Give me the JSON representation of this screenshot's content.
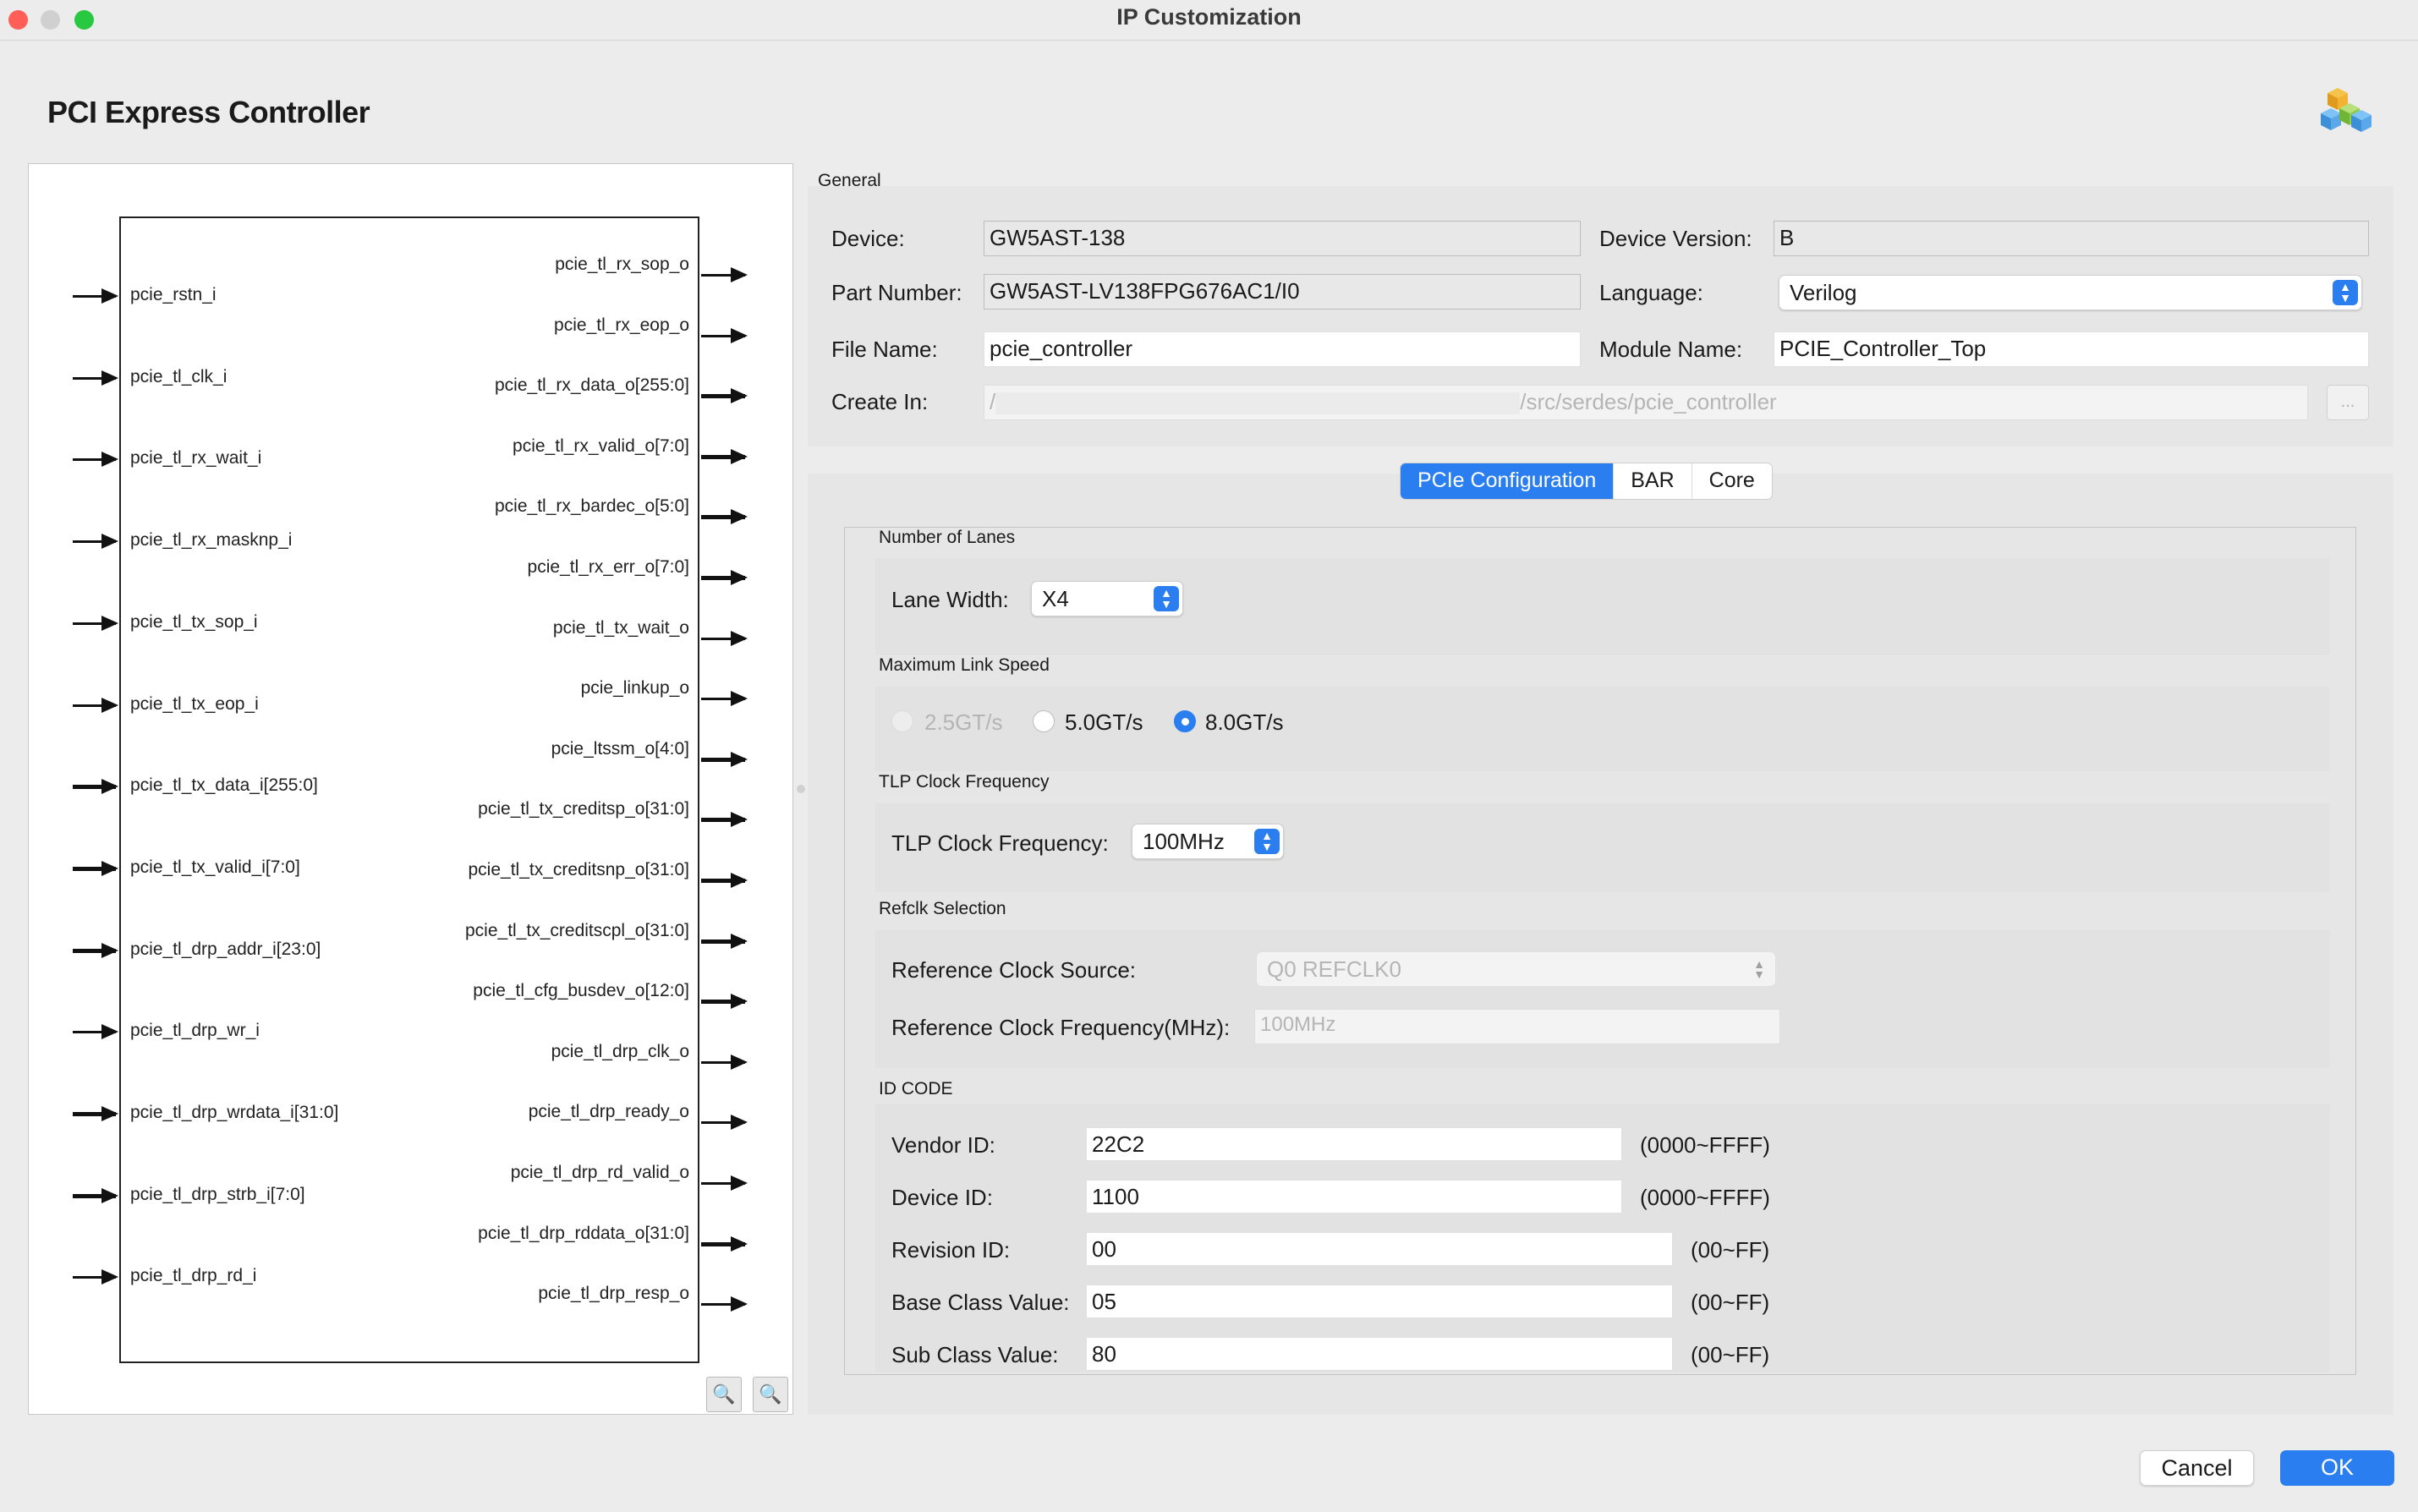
{
  "window": {
    "title": "IP Customization"
  },
  "header": {
    "title": "PCI Express Controller",
    "logo_icon": "ip-cubes-icon"
  },
  "diagram": {
    "left_pins": [
      "pcie_rstn_i",
      "pcie_tl_clk_i",
      "pcie_tl_rx_wait_i",
      "pcie_tl_rx_masknp_i",
      "pcie_tl_tx_sop_i",
      "pcie_tl_tx_eop_i",
      "pcie_tl_tx_data_i[255:0]",
      "pcie_tl_tx_valid_i[7:0]",
      "pcie_tl_drp_addr_i[23:0]",
      "pcie_tl_drp_wr_i",
      "pcie_tl_drp_wrdata_i[31:0]",
      "pcie_tl_drp_strb_i[7:0]",
      "pcie_tl_drp_rd_i"
    ],
    "right_pins": [
      "pcie_tl_rx_sop_o",
      "pcie_tl_rx_eop_o",
      "pcie_tl_rx_data_o[255:0]",
      "pcie_tl_rx_valid_o[7:0]",
      "pcie_tl_rx_bardec_o[5:0]",
      "pcie_tl_rx_err_o[7:0]",
      "pcie_tl_tx_wait_o",
      "pcie_linkup_o",
      "pcie_ltssm_o[4:0]",
      "pcie_tl_tx_creditsp_o[31:0]",
      "pcie_tl_tx_creditsnp_o[31:0]",
      "pcie_tl_tx_creditscpl_o[31:0]",
      "pcie_tl_cfg_busdev_o[12:0]",
      "pcie_tl_drp_clk_o",
      "pcie_tl_drp_ready_o",
      "pcie_tl_drp_rd_valid_o",
      "pcie_tl_drp_rddata_o[31:0]",
      "pcie_tl_drp_resp_o"
    ],
    "zoom_in_icon": "zoom-in-icon",
    "zoom_out_icon": "zoom-out-icon"
  },
  "general": {
    "section_label": "General",
    "device_label": "Device:",
    "device_value": "GW5AST-138",
    "device_version_label": "Device Version:",
    "device_version_value": "B",
    "part_number_label": "Part Number:",
    "part_number_value": "GW5AST-LV138FPG676AC1/I0",
    "language_label": "Language:",
    "language_value": "Verilog",
    "file_name_label": "File Name:",
    "file_name_value": "pcie_controller",
    "module_name_label": "Module Name:",
    "module_name_value": "PCIE_Controller_Top",
    "create_in_label": "Create In:",
    "create_in_prefix": "/",
    "create_in_suffix": "/src/serdes/pcie_controller",
    "browse_label": "..."
  },
  "tabs": [
    "PCIe Configuration",
    "BAR",
    "Core"
  ],
  "config": {
    "lanes": {
      "group": "Number of Lanes",
      "label": "Lane Width:",
      "value": "X4"
    },
    "speed": {
      "group": "Maximum Link Speed",
      "options": [
        "2.5GT/s",
        "5.0GT/s",
        "8.0GT/s"
      ],
      "selected": "8.0GT/s"
    },
    "tlp": {
      "group": "TLP Clock Frequency",
      "label": "TLP Clock Frequency:",
      "value": "100MHz"
    },
    "refclk": {
      "group": "Refclk Selection",
      "source_label": "Reference Clock Source:",
      "source_value": "Q0 REFCLK0",
      "freq_label": "Reference Clock Frequency(MHz):",
      "freq_value": "100MHz"
    },
    "idcode": {
      "group": "ID CODE",
      "rows": [
        {
          "label": "Vendor ID:",
          "value": "22C2",
          "range": "(0000~FFFF)"
        },
        {
          "label": "Device ID:",
          "value": "1100",
          "range": "(0000~FFFF)"
        },
        {
          "label": "Revision ID:",
          "value": "00",
          "range": "(00~FF)"
        },
        {
          "label": "Base Class Value:",
          "value": "05",
          "range": "(00~FF)"
        },
        {
          "label": "Sub Class Value:",
          "value": "80",
          "range": "(00~FF)"
        }
      ]
    }
  },
  "footer": {
    "cancel": "Cancel",
    "ok": "OK"
  },
  "colors": {
    "accent": "#2a7ef0",
    "close": "#ff5f57",
    "minimize": "#d0d0d0",
    "zoom": "#28c840"
  }
}
